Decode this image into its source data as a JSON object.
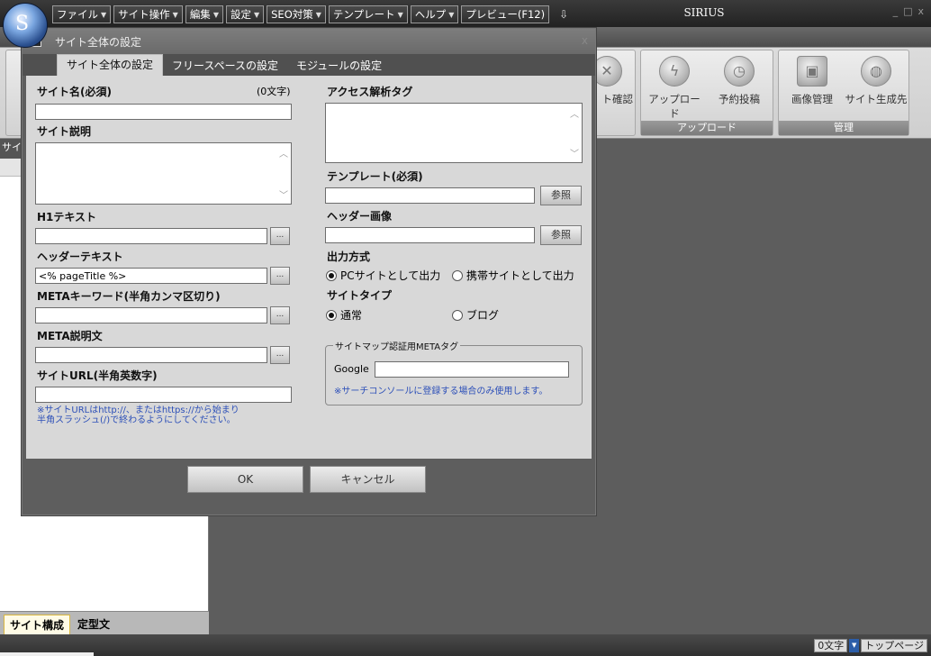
{
  "app": {
    "title": "SIRIUS",
    "orb_glyph": "S",
    "win_controls": [
      "_",
      "□",
      "x"
    ]
  },
  "menu": [
    {
      "label": "ファイル"
    },
    {
      "label": "サイト操作"
    },
    {
      "label": "編集"
    },
    {
      "label": "設定"
    },
    {
      "label": "SEO対策"
    },
    {
      "label": "テンプレート"
    },
    {
      "label": "ヘルプ"
    },
    {
      "label": "プレビュー(F12)"
    }
  ],
  "ribbon": {
    "upload_group": {
      "label": "アップロード",
      "buttons": [
        {
          "label": "ト確認"
        },
        {
          "label": "アップロード"
        },
        {
          "label": "予約投稿"
        }
      ]
    },
    "manage_group": {
      "label": "管理",
      "buttons": [
        {
          "label": "画像管理"
        },
        {
          "label": "サイト生成先"
        }
      ]
    }
  },
  "left_panel": {
    "header_fragment": "サイ",
    "tabs": [
      {
        "label": "サイト構成",
        "active": true
      },
      {
        "label": "定型文",
        "active": false
      }
    ]
  },
  "statusbar": {
    "char_count": "0文字",
    "page": "トップページ"
  },
  "dialog": {
    "title": "サイト全体の設定",
    "close": "x",
    "tabs": [
      {
        "label": "サイト全体の設定",
        "active": true
      },
      {
        "label": "フリースペースの設定",
        "active": false
      },
      {
        "label": "モジュールの設定",
        "active": false
      }
    ],
    "left": {
      "site_name_label": "サイト名(必須)",
      "site_name_count": "(0文字)",
      "site_name_value": "",
      "site_desc_label": "サイト説明",
      "h1_label": "H1テキスト",
      "h1_value": "",
      "header_text_label": "ヘッダーテキスト",
      "header_text_value": "<% pageTitle %>",
      "meta_keywords_label": "METAキーワード(半角カンマ区切り)",
      "meta_keywords_value": "",
      "meta_desc_label": "META説明文",
      "meta_desc_value": "",
      "site_url_label": "サイトURL(半角英数字)",
      "site_url_value": "",
      "site_url_note_1": "※サイトURLはhttp://、またはhttps://から始まり",
      "site_url_note_2": "半角スラッシュ(/)で終わるようにしてください。",
      "dots": "..."
    },
    "right": {
      "access_tag_label": "アクセス解析タグ",
      "template_label": "テンプレート(必須)",
      "template_value": "",
      "header_image_label": "ヘッダー画像",
      "header_image_value": "",
      "browse": "参照",
      "output_label": "出力方式",
      "output_options": [
        {
          "label": "PCサイトとして出力",
          "checked": true
        },
        {
          "label": "携帯サイトとして出力",
          "checked": false
        }
      ],
      "site_type_label": "サイトタイプ",
      "site_type_options": [
        {
          "label": "通常",
          "checked": true
        },
        {
          "label": "ブログ",
          "checked": false
        }
      ],
      "sitemap_legend": "サイトマップ認証用METAタグ",
      "google_label": "Google",
      "google_value": "",
      "sitemap_note": "※サーチコンソールに登録する場合のみ使用します。"
    },
    "ok": "OK",
    "cancel": "キャンセル"
  }
}
